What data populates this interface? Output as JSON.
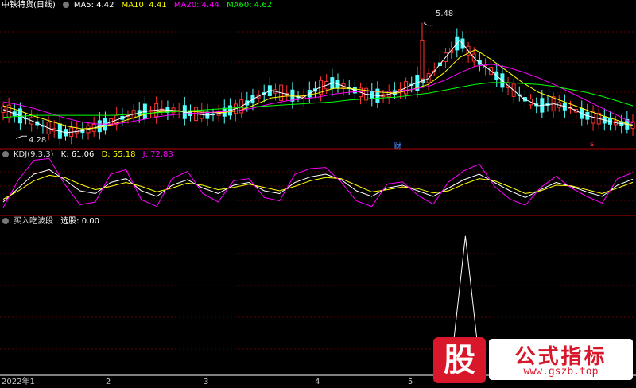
{
  "main": {
    "title": "中铁特货(日线)",
    "ma5": "MA5: 4.42",
    "ma10": "MA10: 4.41",
    "ma20": "MA20: 4.44",
    "ma60": "MA60: 4.62",
    "high_label": "5.48",
    "low_label": "4.28",
    "marker_cai": "财",
    "marker_s": "s",
    "colors": {
      "ma5": "#ffffff",
      "ma10": "#ffff00",
      "ma20": "#ff00ff",
      "ma60": "#00ff00",
      "up": "#ff3232",
      "down": "#54ffff"
    }
  },
  "kdj": {
    "title": "KDJ(9,3,3)",
    "k": "K: 61.06",
    "d": "D: 55.18",
    "j": "J: 72.83"
  },
  "sub": {
    "title": "买入吃波段",
    "value": "选股: 0.00"
  },
  "axis": {
    "labels": [
      "2022年1",
      "2",
      "3",
      "4",
      "5"
    ]
  },
  "watermark": {
    "left_char": "股",
    "title": "公式指标",
    "url": "www.gszb.top"
  },
  "chart_data": [
    {
      "type": "line",
      "title": "中铁特货(日线)",
      "series": [
        {
          "name": "MA5",
          "values": [
            4.58,
            4.52,
            4.45,
            4.38,
            4.34,
            4.36,
            4.4,
            4.46,
            4.52,
            4.56,
            4.58,
            4.57,
            4.54,
            4.52,
            4.55,
            4.6,
            4.7,
            4.78,
            4.74,
            4.7,
            4.8,
            4.86,
            4.8,
            4.74,
            4.72,
            4.76,
            4.84,
            4.9,
            5.1,
            5.3,
            5.1,
            4.98,
            4.84,
            4.7,
            4.62,
            4.64,
            4.6,
            4.52,
            4.48,
            4.44,
            4.42
          ]
        },
        {
          "name": "MA10",
          "values": [
            4.62,
            4.57,
            4.51,
            4.46,
            4.41,
            4.38,
            4.39,
            4.43,
            4.48,
            4.53,
            4.56,
            4.57,
            4.56,
            4.55,
            4.55,
            4.57,
            4.63,
            4.7,
            4.72,
            4.72,
            4.75,
            4.8,
            4.8,
            4.78,
            4.76,
            4.75,
            4.79,
            4.84,
            4.96,
            5.12,
            5.2,
            5.1,
            4.98,
            4.86,
            4.76,
            4.7,
            4.64,
            4.58,
            4.52,
            4.47,
            4.41
          ]
        },
        {
          "name": "MA20",
          "values": [
            4.66,
            4.63,
            4.59,
            4.54,
            4.49,
            4.45,
            4.43,
            4.43,
            4.45,
            4.48,
            4.51,
            4.53,
            4.54,
            4.55,
            4.56,
            4.57,
            4.6,
            4.64,
            4.67,
            4.69,
            4.71,
            4.74,
            4.76,
            4.77,
            4.77,
            4.77,
            4.79,
            4.82,
            4.88,
            4.96,
            5.03,
            5.05,
            5.02,
            4.97,
            4.91,
            4.84,
            4.76,
            4.68,
            4.6,
            4.52,
            4.44
          ]
        },
        {
          "name": "MA60",
          "values": [
            4.5,
            4.51,
            4.52,
            4.52,
            4.52,
            4.52,
            4.52,
            4.52,
            4.53,
            4.54,
            4.55,
            4.56,
            4.57,
            4.58,
            4.59,
            4.6,
            4.61,
            4.62,
            4.63,
            4.64,
            4.65,
            4.66,
            4.68,
            4.69,
            4.7,
            4.71,
            4.73,
            4.75,
            4.78,
            4.81,
            4.84,
            4.86,
            4.86,
            4.85,
            4.84,
            4.82,
            4.79,
            4.76,
            4.72,
            4.67,
            4.62
          ]
        }
      ],
      "high": 5.48,
      "low": 4.28,
      "ylim": [
        4.2,
        5.6
      ]
    },
    {
      "type": "line",
      "title": "KDJ(9,3,3)",
      "series": [
        {
          "name": "K",
          "values": [
            20,
            45,
            70,
            78,
            60,
            40,
            35,
            55,
            62,
            40,
            30,
            50,
            60,
            45,
            35,
            50,
            55,
            40,
            35,
            55,
            65,
            70,
            60,
            40,
            30,
            45,
            50,
            40,
            30,
            45,
            60,
            70,
            55,
            40,
            28,
            42,
            55,
            48,
            38,
            30,
            50,
            61.06
          ]
        },
        {
          "name": "D",
          "values": [
            25,
            40,
            58,
            68,
            64,
            52,
            42,
            48,
            55,
            48,
            38,
            45,
            54,
            50,
            42,
            46,
            52,
            46,
            40,
            48,
            58,
            64,
            62,
            50,
            38,
            42,
            47,
            44,
            36,
            40,
            52,
            62,
            58,
            47,
            35,
            40,
            50,
            49,
            42,
            35,
            45,
            55.18
          ]
        },
        {
          "name": "J",
          "values": [
            10,
            60,
            95,
            98,
            52,
            15,
            20,
            70,
            78,
            24,
            12,
            62,
            75,
            35,
            20,
            58,
            62,
            28,
            22,
            70,
            80,
            82,
            56,
            22,
            12,
            52,
            56,
            32,
            16,
            56,
            76,
            88,
            48,
            25,
            14,
            46,
            66,
            45,
            30,
            18,
            62,
            72.83
          ]
        }
      ],
      "ylim": [
        0,
        100
      ]
    },
    {
      "type": "line",
      "title": "买入吃波段",
      "series": [
        {
          "name": "选股",
          "values": [
            0,
            0,
            0,
            0,
            0,
            0,
            0,
            0,
            0,
            0,
            0,
            0,
            0,
            0,
            0,
            0,
            0,
            0,
            0,
            0,
            0,
            0,
            0,
            0,
            0,
            0,
            0,
            0,
            0,
            0,
            1,
            0,
            0,
            0,
            0,
            0,
            0,
            0,
            0,
            0,
            0,
            0.0
          ]
        }
      ],
      "ylim": [
        0,
        1.05
      ]
    }
  ]
}
